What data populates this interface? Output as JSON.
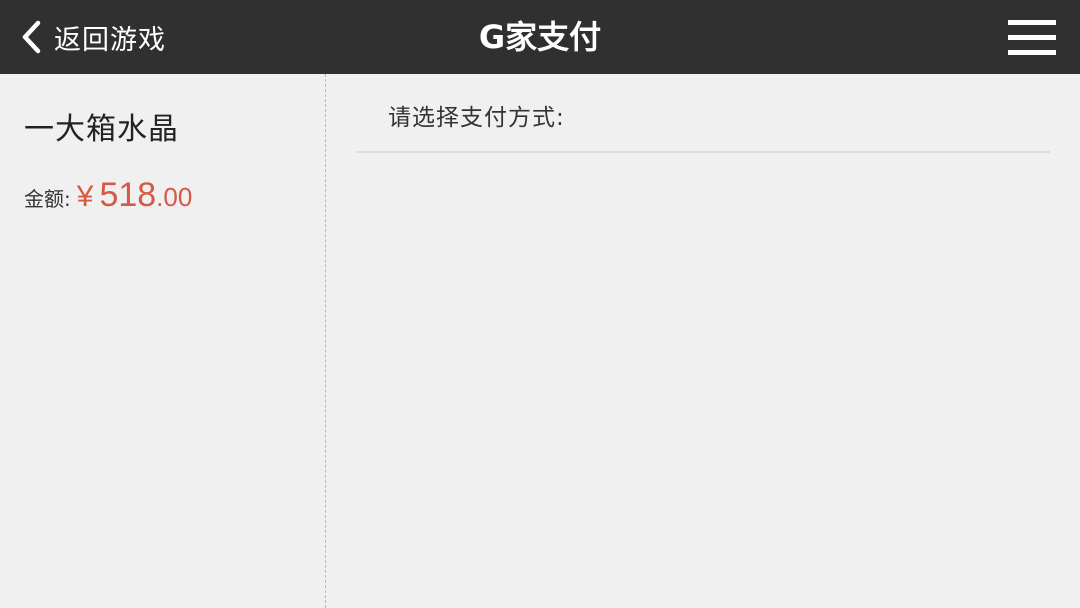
{
  "header": {
    "back_label": "返回游戏",
    "title": "G家支付"
  },
  "order": {
    "product_name": "一大箱水晶",
    "amount_label": "金额:",
    "currency_symbol": "¥",
    "amount_integer": "518",
    "amount_decimal": ".00"
  },
  "payment": {
    "section_title": "请选择支付方式:"
  },
  "colors": {
    "header_bg": "#303030",
    "page_bg": "#f0f0f0",
    "price": "#d45a46"
  },
  "icons": {
    "back": "chevron-left-icon",
    "menu": "hamburger-menu-icon"
  }
}
